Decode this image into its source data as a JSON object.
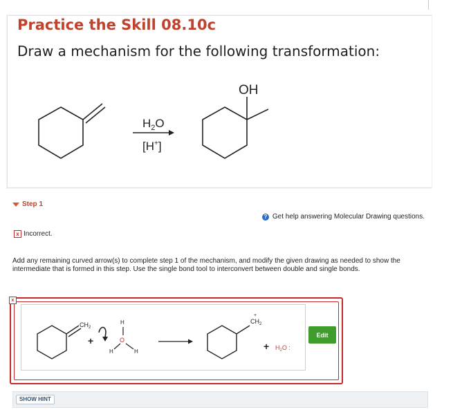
{
  "problem": {
    "title": "Practice the Skill 08.10c",
    "subtitle": "Draw a mechanism for the following transformation:",
    "reaction": {
      "product_label": "OH",
      "reagent_top": "H",
      "reagent_top_sub": "2",
      "reagent_top_suffix": "O",
      "reagent_bottom": "[H",
      "reagent_bottom_sup": "+",
      "reagent_bottom_suffix": "]"
    }
  },
  "step": {
    "label": "Step 1",
    "help_text": "Get help answering Molecular Drawing questions.",
    "help_icon": "?",
    "status_icon": "x",
    "status": "Incorrect.",
    "instructions": "Add any remaining curved arrow(s) to complete step 1 of the mechanism, and modify the given drawing as needed to show the intermediate that is formed in this step. Use the single bond tool to interconvert between double and single bonds."
  },
  "drawing": {
    "close_icon": "x",
    "edit_label": "Edit",
    "left_group": "CH",
    "left_group_sub": "2",
    "plus_left": "+",
    "water_h_top": "H",
    "water_o": "O",
    "water_h_left": "H",
    "water_h_right": "H",
    "product_group": "CH",
    "product_group_sub": "2",
    "product_charge": "+",
    "plus_right": "+",
    "water_product": "H",
    "water_product_sub": "2",
    "water_product_suffix": "O :",
    "colors": {
      "border": "#c62828",
      "edit": "#3e9c2d",
      "product_water": "#d23b2b"
    }
  },
  "hint": {
    "label": "SHOW HINT"
  }
}
